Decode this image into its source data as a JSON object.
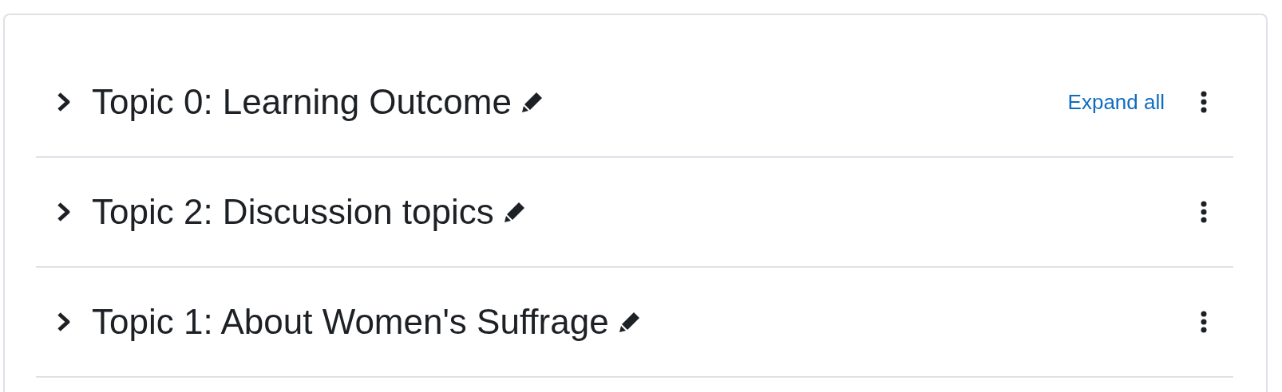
{
  "expand_all": "Expand all",
  "sections": [
    {
      "title": "Topic 0: Learning Outcome",
      "expanded": false
    },
    {
      "title": "Topic 2: Discussion topics",
      "expanded": false
    },
    {
      "title": "Topic 1: About Women's Suffrage",
      "expanded": false
    }
  ]
}
